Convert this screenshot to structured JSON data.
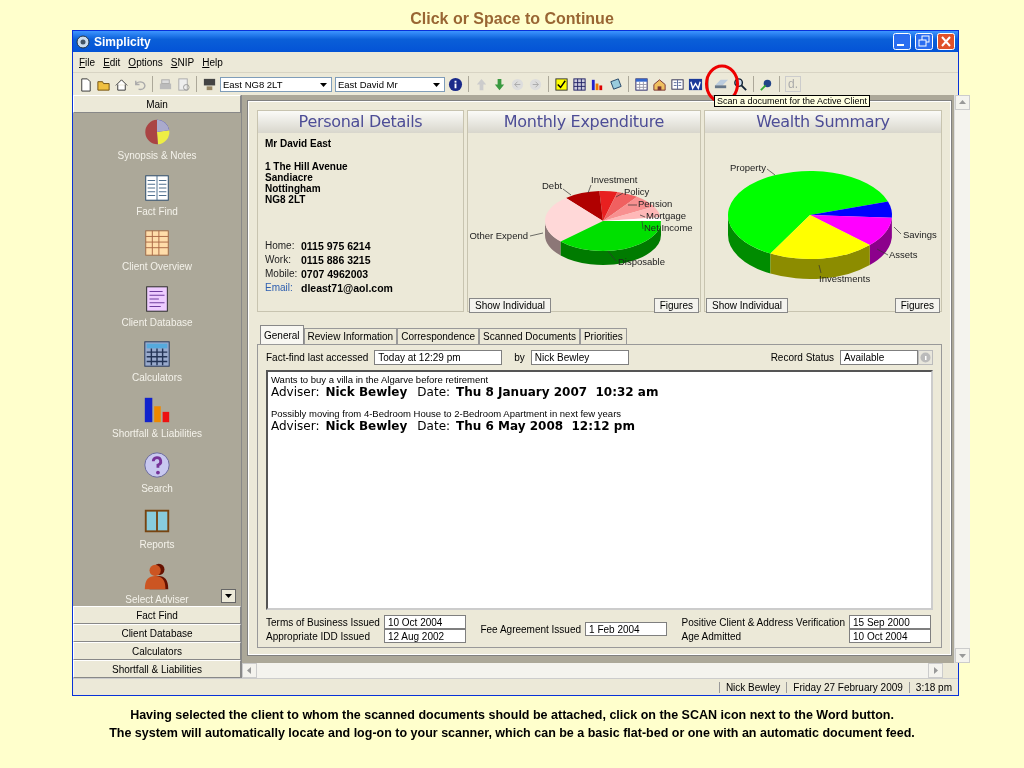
{
  "slide_title": "Click or Space to Continue",
  "window": {
    "title": "Simplicity"
  },
  "menu": [
    "File",
    "Edit",
    "Options",
    "SNIP",
    "Help"
  ],
  "toolbar": {
    "client_postcode": "East NG8 2LT",
    "client_name": "East David Mr",
    "logo": "d.",
    "tooltip": "Scan a document for the Active Client"
  },
  "sidebar": {
    "header": "Main",
    "items": [
      "Synopsis & Notes",
      "Fact Find",
      "Client Overview",
      "Client Database",
      "Calculators",
      "Shortfall & Liabilities",
      "Search",
      "Reports",
      "Select Adviser"
    ],
    "sections": [
      "Fact Find",
      "Client Database",
      "Calculators",
      "Shortfall & Liabilities"
    ]
  },
  "personal_details": {
    "title": "Personal Details",
    "name": "Mr David East",
    "address": [
      "1 The Hill Avenue",
      "Sandiacre",
      "Nottingham",
      "NG8 2LT"
    ],
    "contacts": [
      {
        "label": "Home:",
        "value": "0115 975 6214",
        "kind": "phone"
      },
      {
        "label": "Work:",
        "value": "0115 886 3215",
        "kind": "phone"
      },
      {
        "label": "Mobile:",
        "value": "0707 4962003",
        "kind": "phone"
      },
      {
        "label": "Email:",
        "value": "dleast71@aol.com",
        "kind": "email"
      }
    ]
  },
  "charts": [
    {
      "title": "Monthly Expenditure",
      "slices": [
        {
          "label": "Disposable",
          "color": "#00e000"
        },
        {
          "label": "Other Expend",
          "color": "#ffd8d8"
        },
        {
          "label": "Debt",
          "color": "#b00000"
        },
        {
          "label": "Investment",
          "color": "#e82020"
        },
        {
          "label": "Policy",
          "color": "#f06060"
        },
        {
          "label": "Pension",
          "color": "#f89090"
        },
        {
          "label": "Mortgage",
          "color": "#ffb8b8"
        },
        {
          "label": "Net Income",
          "color": "#ffffff"
        }
      ],
      "buttons": [
        "Show Individual",
        "Figures"
      ]
    },
    {
      "title": "Wealth Summary",
      "slices": [
        {
          "label": "Savings",
          "color": "#0000ff"
        },
        {
          "label": "Assets",
          "color": "#ff00ff"
        },
        {
          "label": "Investments",
          "color": "#ffff00"
        },
        {
          "label": "Property",
          "color": "#00ff00"
        }
      ],
      "buttons": [
        "Show Individual",
        "Figures"
      ]
    }
  ],
  "tabs": [
    {
      "label": "General",
      "selected": true
    },
    {
      "label": "Review Information",
      "selected": false
    },
    {
      "label": "Correspondence",
      "selected": false
    },
    {
      "label": "Scanned Documents",
      "selected": false
    },
    {
      "label": "Priorities",
      "selected": false
    }
  ],
  "general": {
    "last_accessed_label": "Fact-find last accessed",
    "last_accessed": "Today at 12:29 pm",
    "by_label": "by",
    "by": "Nick Bewley",
    "record_status_label": "Record Status",
    "record_status": "Available",
    "notes": [
      {
        "text": "Wants to buy a villa in the Algarve before retirement",
        "adviser_label": "Adviser:",
        "adviser": "Nick Bewley",
        "date_label": "Date:",
        "date": "Thu 8 January 2007  10:32 am"
      },
      {
        "text": "Possibly moving from 4-Bedroom House to 2-Bedroom Apartment in next few years",
        "adviser_label": "Adviser:",
        "adviser": "Nick Bewley",
        "date_label": "Date:",
        "date": "Thu 6 May 2008  12:12 pm"
      }
    ],
    "date_groups": [
      [
        {
          "label": "Terms of Business Issued",
          "value": "10 Oct 2004"
        },
        {
          "label": "Appropriate IDD Issued",
          "value": "12 Aug 2002"
        }
      ],
      [
        {
          "label": "Fee Agreement Issued",
          "value": "1 Feb 2004"
        }
      ],
      [
        {
          "label": "Positive Client & Address Verification",
          "value": "15 Sep 2000"
        },
        {
          "label": "Age Admitted",
          "value": "10 Oct 2004"
        }
      ]
    ]
  },
  "status_bar": [
    "Nick Bewley",
    "Friday 27 February 2009",
    "3:18 pm"
  ],
  "caption": [
    "Having selected the client to whom the scanned documents should be attached, click on the SCAN icon next to the Word button.",
    "The system will automatically locate and log-on to your scanner, which can be a basic flat-bed or one with an automatic document feed."
  ]
}
